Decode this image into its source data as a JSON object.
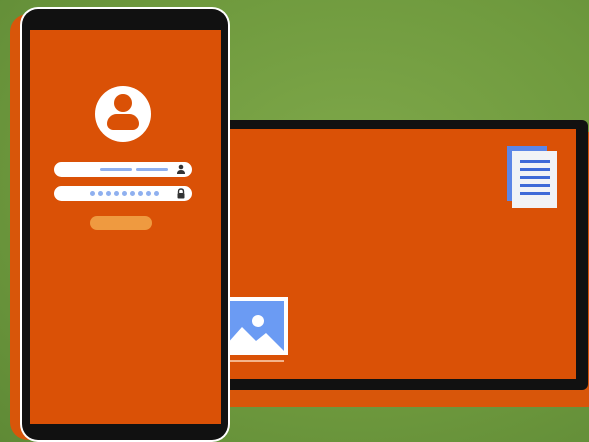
{
  "scene": {
    "colors": {
      "background": "#6f9a3e",
      "screen": "#da5106",
      "device_frame": "#111111",
      "accent_blue": "#6b9bf3",
      "button": "#ef9a40"
    }
  },
  "phone": {
    "login_screen": {
      "avatar_icon": "user-icon",
      "username_field": {
        "icon": "user-icon",
        "value": ""
      },
      "password_field": {
        "icon": "lock-icon",
        "masked_dots": 9
      },
      "login_button_label": ""
    }
  },
  "tablet": {
    "document_icon": "document-icon",
    "image_icon": "image-icon"
  }
}
